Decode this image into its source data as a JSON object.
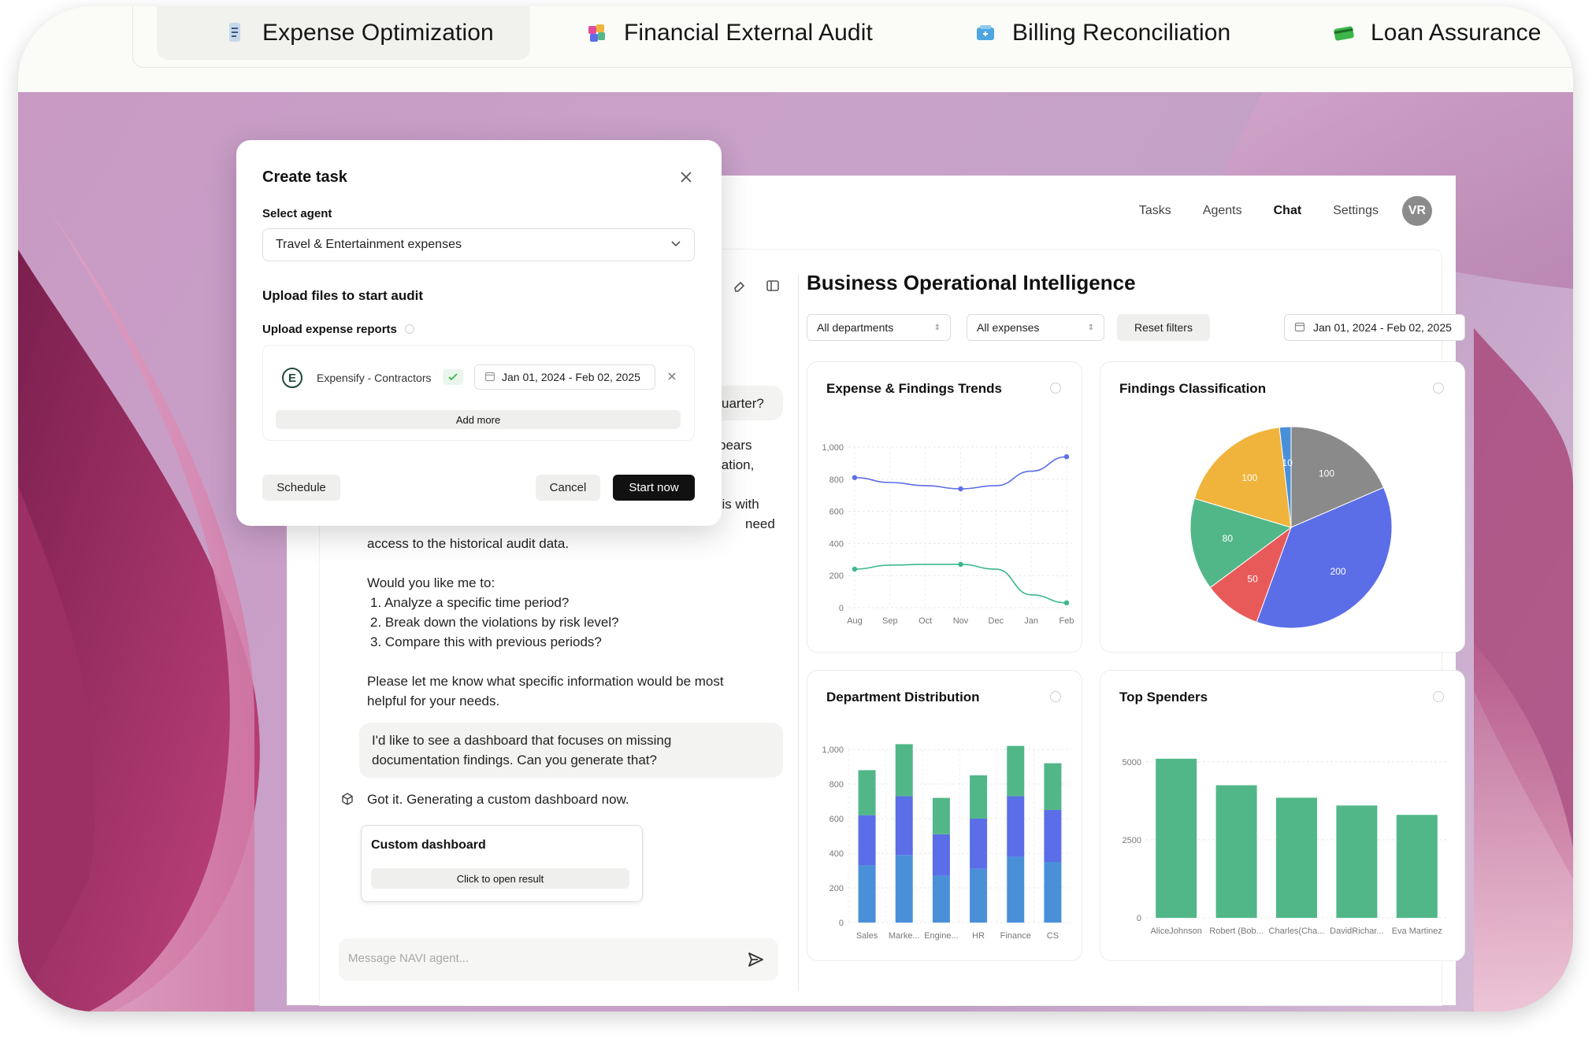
{
  "tabs": [
    {
      "label": "Expense Optimization",
      "icon": "document-icon",
      "active": true
    },
    {
      "label": "Financial External Audit",
      "icon": "puzzle-icon",
      "active": false
    },
    {
      "label": "Billing Reconciliation",
      "icon": "box-icon",
      "active": false
    },
    {
      "label": "Loan Assurance",
      "icon": "card-icon",
      "active": false
    }
  ],
  "nav": {
    "tasks": "Tasks",
    "agents": "Agents",
    "chat": "Chat",
    "settings": "Settings",
    "avatar": "VR"
  },
  "chat": {
    "frag1": "uarter?",
    "frag2": "pears",
    "frag3": "lation,",
    "frag4": "sis with",
    "frag5": "need",
    "line_access": "access to the historical audit data.",
    "would_like": "Would you like me to:",
    "options": [
      "1. Analyze a specific time period?",
      "2. Break down the violations by risk level?",
      "3. Compare this with previous periods?"
    ],
    "please_1": "Please let me know what specific information would be most",
    "please_2": "helpful for your needs.",
    "user_msg_1": "I'd like to see a dashboard that focuses on missing",
    "user_msg_2": "documentation findings. Can you generate that?",
    "agent_msg": "Got it. Generating a custom dashboard now.",
    "result_title": "Custom dashboard",
    "result_button": "Click to open result",
    "composer_placeholder": "Message NAVI agent..."
  },
  "dashboard": {
    "title": "Business Operational Intelligence",
    "filter_dept": "All departments",
    "filter_exp": "All expenses",
    "reset": "Reset filters",
    "date_range": "Jan 01, 2024 - Feb 02, 2025",
    "panels": {
      "trends": "Expense & Findings Trends",
      "classification": "Findings Classification",
      "department": "Department Distribution",
      "spenders": "Top Spenders"
    }
  },
  "modal": {
    "title": "Create task",
    "select_agent_label": "Select agent",
    "agent_value": "Travel & Entertainment expenses",
    "upload_heading": "Upload files to start audit",
    "upload_reports_label": "Upload expense reports",
    "source_name": "Expensify - Contractors",
    "source_logo": "E",
    "source_date": "Jan 01, 2024 - Feb 02, 2025",
    "add_more": "Add more",
    "schedule": "Schedule",
    "cancel": "Cancel",
    "start": "Start now"
  },
  "colors": {
    "green": "#52b788",
    "blue": "#4a90d9",
    "indigo": "#5b6ee8",
    "red": "#e85a5a",
    "yellow": "#f0b43c",
    "gray": "#8a8a8a",
    "line_blue": "#5b6ee8",
    "line_green": "#3cb88a"
  },
  "chart_data": [
    {
      "type": "line",
      "title": "Expense & Findings Trends",
      "categories": [
        "Aug",
        "Sep",
        "Oct",
        "Nov",
        "Dec",
        "Jan",
        "Feb"
      ],
      "ylim": [
        0,
        1000
      ],
      "yticks": [
        0,
        200,
        400,
        600,
        800,
        "1,000"
      ],
      "series": [
        {
          "values": [
            810,
            780,
            760,
            740,
            760,
            850,
            940
          ]
        },
        {
          "values": [
            240,
            265,
            270,
            270,
            240,
            80,
            30
          ]
        }
      ]
    },
    {
      "type": "pie",
      "title": "Findings Classification",
      "series": [
        {
          "values": [
            100,
            200,
            50,
            80,
            100,
            10
          ],
          "colors": [
            "#8a8a8a",
            "#5b6ee8",
            "#e85a5a",
            "#52b788",
            "#f0b43c",
            "#4a90d9"
          ]
        }
      ]
    },
    {
      "type": "bar",
      "title": "Department Distribution",
      "stacked": true,
      "categories": [
        "Sales",
        "Marke...",
        "Engine...",
        "HR",
        "Finance",
        "CS"
      ],
      "ylim": [
        0,
        1000
      ],
      "yticks": [
        0,
        200,
        400,
        600,
        800,
        "1,000"
      ],
      "series": [
        {
          "values": [
            330,
            390,
            270,
            310,
            380,
            350
          ],
          "color": "#4a90d9"
        },
        {
          "values": [
            290,
            340,
            240,
            290,
            350,
            300
          ],
          "color": "#5b6ee8"
        },
        {
          "values": [
            260,
            300,
            210,
            250,
            290,
            270
          ],
          "color": "#52b788"
        }
      ]
    },
    {
      "type": "bar",
      "title": "Top Spenders",
      "categories": [
        "AliceJohnson",
        "Robert (Bob...",
        "Charles(Cha...",
        "DavidRichar...",
        "Eva Martinez"
      ],
      "ylim": [
        0,
        5000
      ],
      "yticks": [
        0,
        2500,
        5000
      ],
      "series": [
        {
          "values": [
            5100,
            4250,
            3850,
            3600,
            3300
          ],
          "color": "#52b788"
        }
      ]
    }
  ]
}
